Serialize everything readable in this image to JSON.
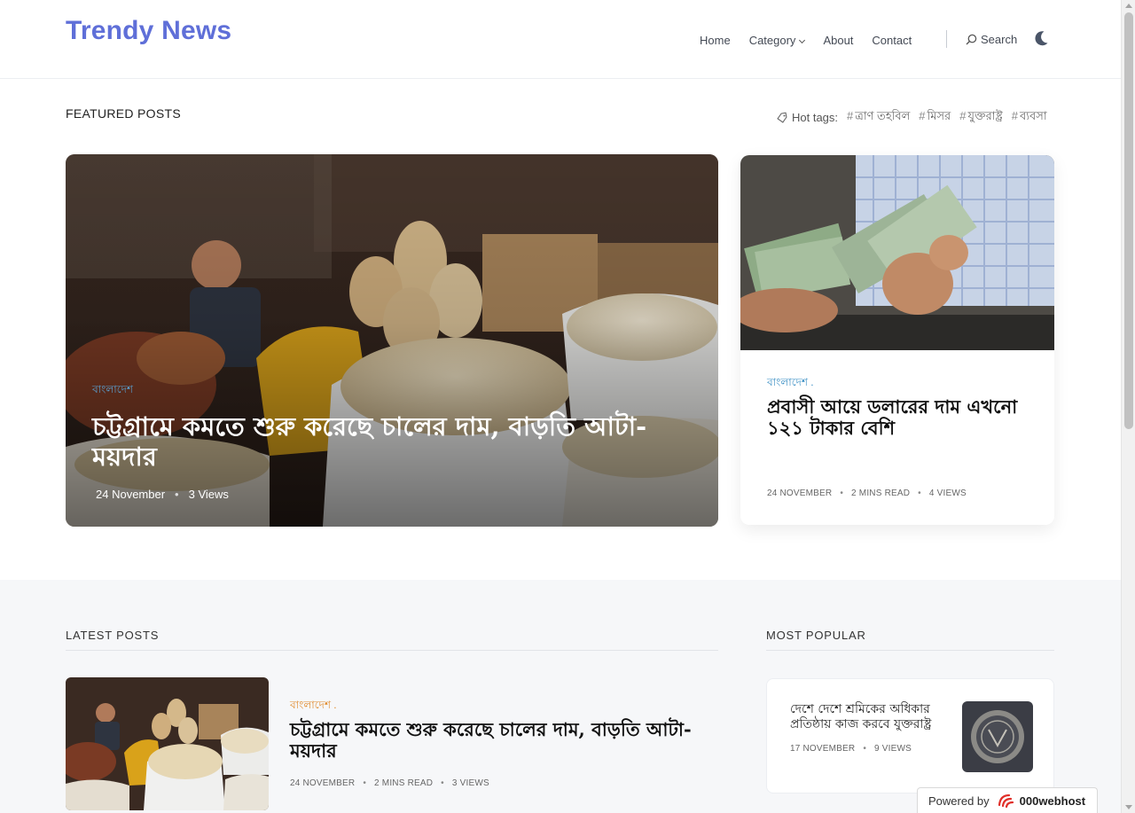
{
  "header": {
    "logo": "Trendy News",
    "nav": [
      {
        "label": "Home"
      },
      {
        "label": "Category"
      },
      {
        "label": "About"
      },
      {
        "label": "Contact"
      }
    ],
    "search_label": "Search",
    "icons": {
      "search": "search-icon",
      "theme_toggle": "moon-icon",
      "dropdown": "chevron-down-icon"
    }
  },
  "featured": {
    "section_title": "FEATURED POSTS",
    "hot_tags_label": "Hot tags:",
    "hot_tags": [
      "ত্রাণ তহবিল",
      "মিসর",
      "যুক্তরাষ্ট্র",
      "ব্যবসা"
    ],
    "main_post": {
      "category": "বাংলাদেশ",
      "title": "চট্টগ্রামে কমতে শুরু করেছে চালের দাম, বাড়তি আটা-ময়দার",
      "date": "24 November",
      "views": "3 Views"
    },
    "side_post": {
      "category": "বাংলাদেশ .",
      "title": "প্রবাসী আয়ে ডলারের দাম এখনো ১২১ টাকার বেশি",
      "date": "24 NOVEMBER",
      "read_time": "2 MINS READ",
      "views": "4 VIEWS"
    }
  },
  "latest": {
    "section_title": "LATEST POSTS",
    "posts": [
      {
        "category": "বাংলাদেশ .",
        "title": "চট্টগ্রামে কমতে শুরু করেছে চালের দাম, বাড়তি আটা-ময়দার",
        "date": "24 NOVEMBER",
        "read_time": "2 MINS READ",
        "views": "3 VIEWS"
      }
    ]
  },
  "popular": {
    "section_title": "MOST POPULAR",
    "posts": [
      {
        "title": "দেশে দেশে শ্রমিকের অধিকার প্রতিষ্ঠায় কাজ করবে যুক্তরাষ্ট্র",
        "date": "17 NOVEMBER",
        "views": "9 VIEWS"
      }
    ]
  },
  "footer_badge": {
    "label": "Powered by",
    "brand": "000webhost"
  },
  "colors": {
    "brand": "#5f6fd8",
    "category_blue": "#3a8fc4",
    "category_orange": "#e08a2a",
    "section_bg": "#f6f7f9"
  }
}
